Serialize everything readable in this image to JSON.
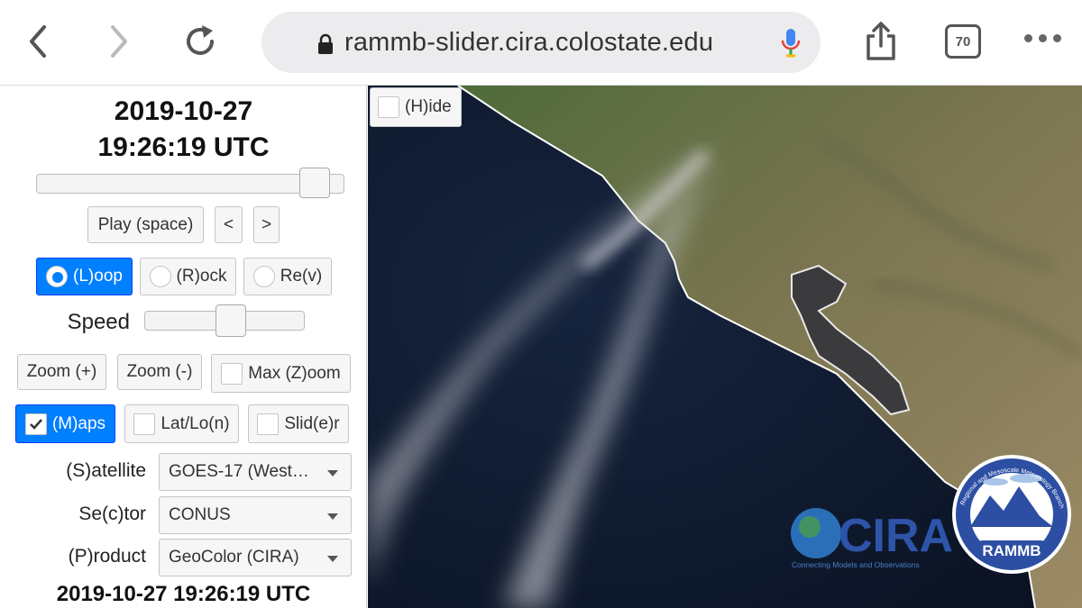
{
  "browser": {
    "url": "rammb-slider.cira.colostate.edu",
    "tab_count": "70"
  },
  "panel": {
    "date_line1": "2019-10-27",
    "date_line2": "19:26:19 UTC",
    "timeline_position": 0.95,
    "play_label": "Play (space)",
    "prev_label": "<",
    "next_label": ">",
    "loop_label": "(L)oop",
    "rock_label": "(R)ock",
    "rev_label": "Re(v)",
    "speed_label": "Speed",
    "speed_position": 0.55,
    "zoom_in_label": "Zoom (+)",
    "zoom_out_label": "Zoom (-)",
    "max_zoom_label": "Max (Z)oom",
    "maps_label": "(M)aps",
    "latlon_label": "Lat/Lo(n)",
    "slider_label": "Slid(e)r",
    "satellite_label": "(S)atellite",
    "satellite_value": "GOES-17 (West…",
    "sector_label": "Se(c)tor",
    "sector_value": "CONUS",
    "product_label": "(P)roduct",
    "product_value": "GeoColor (CIRA)",
    "bottom_date": "2019-10-27 19:26:19 UTC"
  },
  "imagery": {
    "hide_label": "(H)ide",
    "cira_logo_text": "CIRA",
    "cira_tagline": "Connecting Models and Observations",
    "rammb_logo_text": "RAMMB",
    "rammb_arc_text": "Regional and Mesoscale Meteorology Branch"
  },
  "colors": {
    "accent": "#007fff",
    "ocean": "#0f1a2e",
    "land": "#7d7a52"
  }
}
